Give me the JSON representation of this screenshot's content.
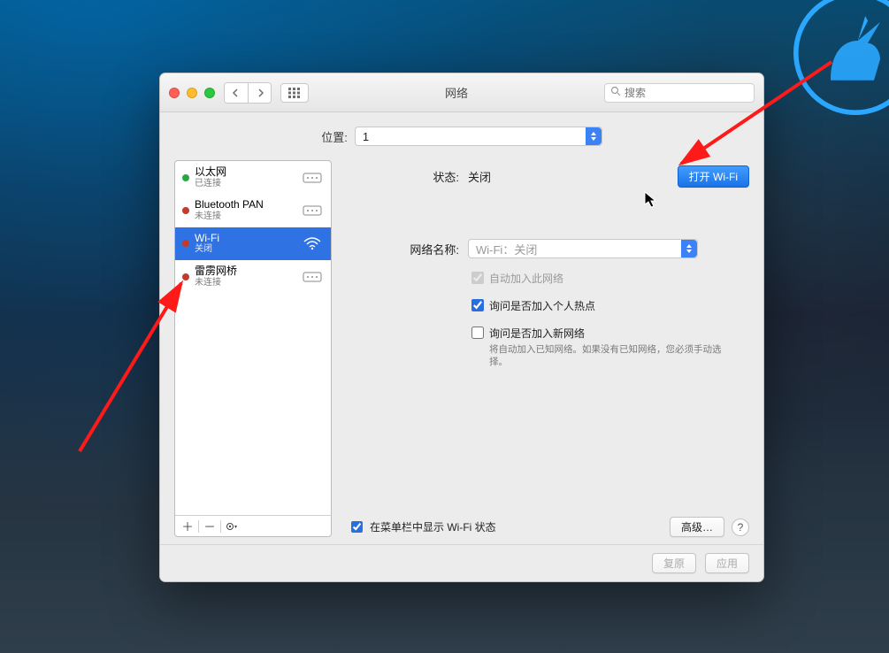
{
  "window": {
    "title": "网络",
    "search_placeholder": "搜索"
  },
  "location": {
    "label": "位置:",
    "value": "1"
  },
  "sidebar": {
    "items": [
      {
        "name": "以太网",
        "sub": "已连接",
        "status": "green",
        "icon": "ethernet"
      },
      {
        "name": "Bluetooth PAN",
        "sub": "未连接",
        "status": "red",
        "icon": "ethernet"
      },
      {
        "name": "Wi-Fi",
        "sub": "关闭",
        "status": "red",
        "icon": "wifi",
        "selected": true
      },
      {
        "name": "雷雳网桥",
        "sub": "未连接",
        "status": "red",
        "icon": "ethernet"
      }
    ]
  },
  "detail": {
    "status_label": "状态:",
    "status_value": "关闭",
    "turn_on_label": "打开 Wi-Fi",
    "network_name_label": "网络名称:",
    "network_name_value": "Wi-Fi：关闭",
    "auto_join_label": "自动加入此网络",
    "ask_hotspot_label": "询问是否加入个人热点",
    "ask_new_label": "询问是否加入新网络",
    "ask_new_help": "将自动加入已知网络。如果没有已知网络，您必须手动选择。",
    "show_status_label": "在菜单栏中显示 Wi-Fi 状态",
    "advanced_label": "高级…"
  },
  "bottom": {
    "revert": "复原",
    "apply": "应用"
  }
}
